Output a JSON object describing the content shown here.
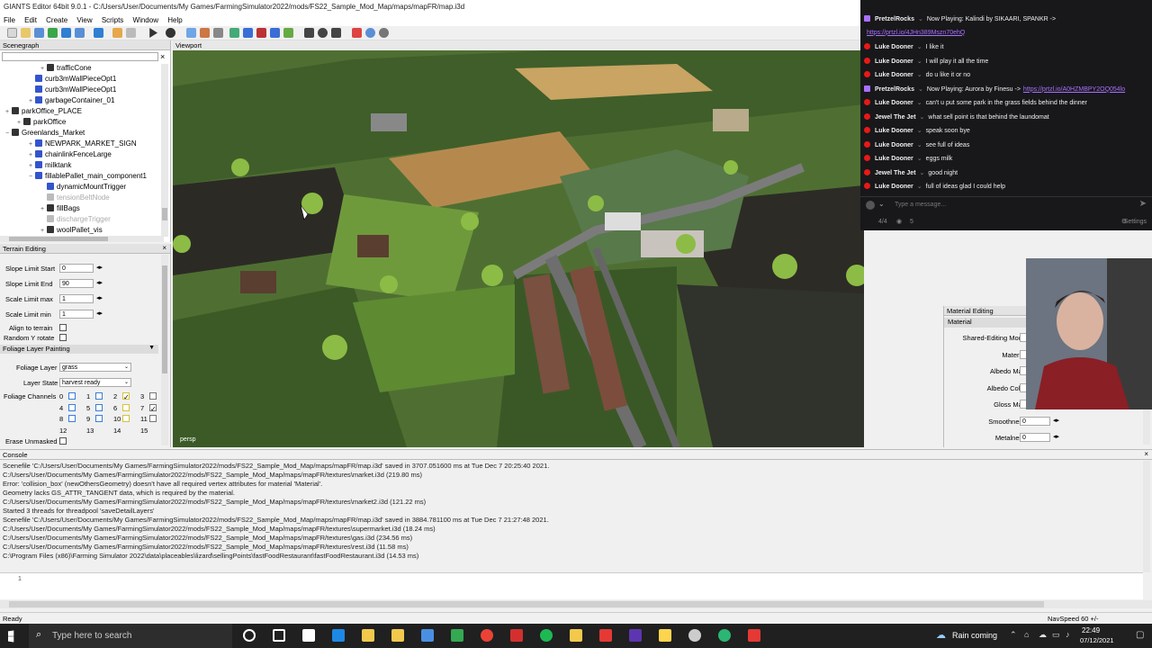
{
  "window": {
    "title": "GIANTS Editor 64bit 9.0.1 - C:/Users/User/Documents/My Games/FarmingSimulator2022/mods/FS22_Sample_Mod_Map/maps/mapFR/map.i3d"
  },
  "menu": [
    "File",
    "Edit",
    "Create",
    "View",
    "Scripts",
    "Window",
    "Help"
  ],
  "scenegraph": {
    "title": "Scenegraph",
    "items": [
      {
        "label": "trafficCone",
        "indent": 3,
        "icon": "dark",
        "expand": "+"
      },
      {
        "label": "curb3mWallPieceOpt1",
        "indent": 2,
        "icon": "blue",
        "expand": ""
      },
      {
        "label": "curb3mWallPieceOpt1",
        "indent": 2,
        "icon": "blue",
        "expand": ""
      },
      {
        "label": "garbageContainer_01",
        "indent": 2,
        "icon": "blue",
        "expand": "+"
      },
      {
        "label": "parkOffice_PLACE",
        "indent": 0,
        "icon": "dark",
        "expand": "+"
      },
      {
        "label": "parkOffice",
        "indent": 1,
        "icon": "dark",
        "expand": "+"
      },
      {
        "label": "Greenlands_Market",
        "indent": 0,
        "icon": "dark",
        "expand": "−"
      },
      {
        "label": "NEWPARK_MARKET_SIGN",
        "indent": 2,
        "icon": "blue",
        "expand": "+"
      },
      {
        "label": "chainlinkFenceLarge",
        "indent": 2,
        "icon": "blue",
        "expand": "+"
      },
      {
        "label": "milktank",
        "indent": 2,
        "icon": "blue",
        "expand": "+"
      },
      {
        "label": "fillablePallet_main_component1",
        "indent": 2,
        "icon": "blue",
        "expand": "−"
      },
      {
        "label": "dynamicMountTrigger",
        "indent": 3,
        "icon": "blue",
        "expand": ""
      },
      {
        "label": "tensionBeltNode",
        "indent": 3,
        "icon": "grey",
        "expand": ""
      },
      {
        "label": "fillBags",
        "indent": 3,
        "icon": "dark",
        "expand": "+"
      },
      {
        "label": "dischargeTrigger",
        "indent": 3,
        "icon": "grey",
        "expand": ""
      },
      {
        "label": "woolPallet_vis",
        "indent": 3,
        "icon": "dark",
        "expand": "+"
      }
    ]
  },
  "terrain": {
    "title": "Terrain Editing",
    "fields": [
      {
        "label": "Slope Limit Start",
        "value": "0"
      },
      {
        "label": "Slope Limit End",
        "value": "90"
      },
      {
        "label": "Scale Limit max",
        "value": "1"
      },
      {
        "label": "Scale Limit min",
        "value": "1"
      }
    ],
    "align_label": "Align to terrain",
    "random_label": "Random Y rotate",
    "foliage_header": "Foliage Layer Painting",
    "foliage_layer_label": "Foliage Layer",
    "foliage_layer_value": "grass",
    "layer_state_label": "Layer State",
    "layer_state_value": "harvest ready",
    "channels_label": "Foliage Channels",
    "channels": [
      "0",
      "1",
      "2",
      "3",
      "4",
      "5",
      "6",
      "7",
      "8",
      "9",
      "10",
      "11",
      "12",
      "13",
      "14",
      "15"
    ],
    "erase_label": "Erase Unmasked"
  },
  "viewport": {
    "title": "Viewport",
    "camera": "persp"
  },
  "chat": {
    "messages": [
      {
        "user": "PretzelRocks",
        "text": "Now Playing: Kalindi by SIKAARI, SPANKR ->",
        "link": ""
      },
      {
        "user": "",
        "text": "",
        "link": "https://prtzl.io/4JHn389Mszn70ehQ"
      },
      {
        "user": "Luke Dooner",
        "text": "I like it",
        "link": ""
      },
      {
        "user": "Luke Dooner",
        "text": "I will play it all the time",
        "link": ""
      },
      {
        "user": "Luke Dooner",
        "text": "do u like it or no",
        "link": ""
      },
      {
        "user": "PretzelRocks",
        "text": "Now Playing: Aurora by Finesu ->",
        "link": "https://prtzl.io/A0HZMBPY2OQ054lo"
      },
      {
        "user": "Luke Dooner",
        "text": "can't u put some park in the grass fields behind the dinner",
        "link": ""
      },
      {
        "user": "Jewel The Jet",
        "text": "what sell point is that behind the laundomat",
        "link": ""
      },
      {
        "user": "Luke Dooner",
        "text": "speak soon bye",
        "link": ""
      },
      {
        "user": "Luke Dooner",
        "text": "see full of ideas",
        "link": ""
      },
      {
        "user": "Luke Dooner",
        "text": "eggs milk",
        "link": ""
      },
      {
        "user": "Jewel The Jet",
        "text": "good night",
        "link": ""
      },
      {
        "user": "Luke Dooner",
        "text": "full of ideas glad I could help",
        "link": ""
      }
    ],
    "input_placeholder": "Type a message...",
    "counter": "4/4",
    "viewers": "5",
    "settings_label": "Settings",
    "colors": {
      "purple": "#a970ff",
      "red": "#e91916",
      "bg": "#18181b"
    }
  },
  "material": {
    "title": "Material Editing",
    "tab": "Material",
    "rows": [
      {
        "label": "Shared-Editing Mode",
        "value": ""
      },
      {
        "label": "Material",
        "value": ""
      },
      {
        "label": "Albedo Map",
        "value": ""
      },
      {
        "label": "Albedo Color",
        "value": ""
      },
      {
        "label": "Gloss Map",
        "value": ""
      },
      {
        "label": "Smoothness",
        "value": "0"
      },
      {
        "label": "Metalness",
        "value": "0"
      }
    ]
  },
  "console": {
    "title": "Console",
    "lines": [
      "Scenefile 'C:/Users/User/Documents/My Games/FarmingSimulator2022/mods/FS22_Sample_Mod_Map/maps/mapFR/map.i3d' saved in 3707.051600 ms at Tue Dec  7 20:25:40 2021.",
      "C:/Users/User/Documents/My Games/FarmingSimulator2022/mods/FS22_Sample_Mod_Map/maps/mapFR/textures\\market.i3d (219.80 ms)",
      "Error: 'collision_box' (newOthersGeometry) doesn't have all required vertex attributes for material 'Material'.",
      "  Geometry lacks GS_ATTR_TANGENT data, which is required by the material.",
      "C:/Users/User/Documents/My Games/FarmingSimulator2022/mods/FS22_Sample_Mod_Map/maps/mapFR/textures\\market2.i3d (121.22 ms)",
      "Started 3 threads for threadpool 'saveDetailLayers'",
      "Scenefile 'C:/Users/User/Documents/My Games/FarmingSimulator2022/mods/FS22_Sample_Mod_Map/maps/mapFR/map.i3d' saved in 3884.781100 ms at Tue Dec  7 21:27:48 2021.",
      "C:/Users/User/Documents/My Games/FarmingSimulator2022/mods/FS22_Sample_Mod_Map/maps/mapFR/textures\\supermarket.i3d (18.24 ms)",
      "C:/Users/User/Documents/My Games/FarmingSimulator2022/mods/FS22_Sample_Mod_Map/maps/mapFR/textures\\gas.i3d (234.56 ms)",
      "C:/Users/User/Documents/My Games/FarmingSimulator2022/mods/FS22_Sample_Mod_Map/maps/mapFR/textures\\rest.i3d (11.58 ms)",
      "C:\\Program Files (x86)\\Farming Simulator 2022\\data\\placeables\\lizard\\sellingPoints\\fastFoodRestaurant\\fastFoodRestaurant.i3d (14.53 ms)"
    ],
    "line_number": "1"
  },
  "status": {
    "left": "Ready",
    "right": "NavSpeed 60 +/-"
  },
  "taskbar": {
    "search_placeholder": "Type here to search",
    "weather": "Rain coming",
    "time": "22:49",
    "date": "07/12/2021",
    "app_colors": [
      "#ffffff",
      "#ffffff",
      "#ffffff",
      "#1e88e5",
      "#f2c94c",
      "#f2c94c",
      "#4a90e2",
      "#34a853",
      "#ea4335",
      "#d32f2f",
      "#1db954",
      "#f2c94c",
      "#e53935",
      "#5e35b1",
      "#ffd54f",
      "#cccccc",
      "#2bb673",
      "#e53935"
    ]
  }
}
